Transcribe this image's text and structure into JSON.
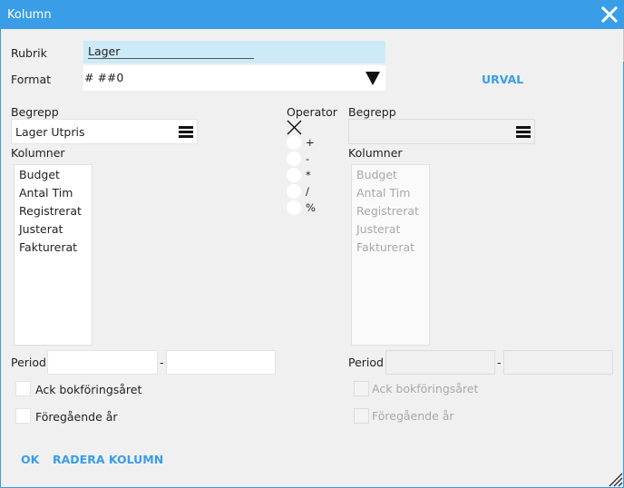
{
  "window": {
    "title": "Kolumn"
  },
  "form": {
    "rubrik_label": "Rubrik",
    "rubrik_value": "Lager",
    "format_label": "Format",
    "format_value": "# ##0",
    "urval_link": "URVAL"
  },
  "left": {
    "begrepp_label": "Begrepp",
    "begrepp_value": "Lager Utpris",
    "kolumner_label": "Kolumner",
    "kolumner": [
      "Budget",
      "Antal Tim",
      "Registrerat",
      "Justerat",
      "Fakturerat"
    ],
    "period_label": "Period",
    "period_separator": "-",
    "ack_label": "Ack bokföringsåret",
    "foregaende_label": "Föregående år"
  },
  "operator": {
    "label": "Operator",
    "options": [
      "+",
      "-",
      "*",
      "/",
      "%"
    ]
  },
  "right": {
    "begrepp_label": "Begrepp",
    "begrepp_value": "",
    "kolumner_label": "Kolumner",
    "kolumner": [
      "Budget",
      "Antal Tim",
      "Registrerat",
      "Justerat",
      "Fakturerat"
    ],
    "period_label": "Period",
    "period_separator": "-",
    "ack_label": "Ack bokföringsåret",
    "foregaende_label": "Föregående år"
  },
  "actions": {
    "ok": "OK",
    "delete": "RADERA KOLUMN"
  },
  "icons": {
    "close": "close-icon",
    "dropdown": "dropdown-arrow-icon",
    "menu": "hamburger-menu-icon",
    "operator_none": "x-mark-icon",
    "resize": "resize-grip-icon"
  },
  "colors": {
    "accent": "#3a9de8",
    "rubrik_bg": "#cdeaf8",
    "dialog_bg": "#f0f0f0"
  }
}
